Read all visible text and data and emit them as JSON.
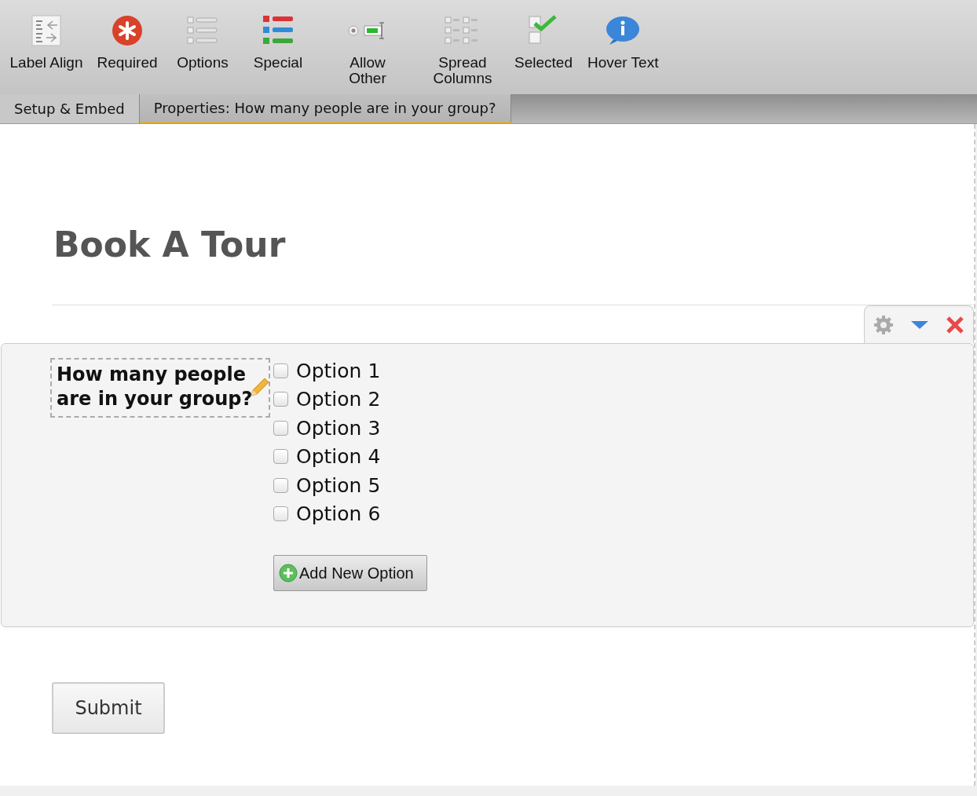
{
  "toolbar": [
    {
      "kind": "label-align",
      "label": "Label Align"
    },
    {
      "kind": "required",
      "label": "Required"
    },
    {
      "kind": "options",
      "label": "Options"
    },
    {
      "kind": "special",
      "label": "Special"
    },
    {
      "kind": "allow-other",
      "label": "Allow Other"
    },
    {
      "kind": "spread-columns",
      "label": "Spread Columns"
    },
    {
      "kind": "selected",
      "label": "Selected"
    },
    {
      "kind": "hover-text",
      "label": "Hover Text"
    }
  ],
  "tabs": [
    {
      "label": "Setup & Embed",
      "selected": false
    },
    {
      "label": "Properties: How many people are in your group?",
      "selected": true
    }
  ],
  "form": {
    "title": "Book A Tour",
    "question": {
      "label": "How many people are in your group?",
      "options": [
        {
          "label": "Option 1",
          "checked": false
        },
        {
          "label": "Option 2",
          "checked": false
        },
        {
          "label": "Option 3",
          "checked": false
        },
        {
          "label": "Option 4",
          "checked": false
        },
        {
          "label": "Option 5",
          "checked": false
        },
        {
          "label": "Option 6",
          "checked": false
        }
      ],
      "add_button": "Add New Option"
    },
    "submit": "Submit"
  }
}
